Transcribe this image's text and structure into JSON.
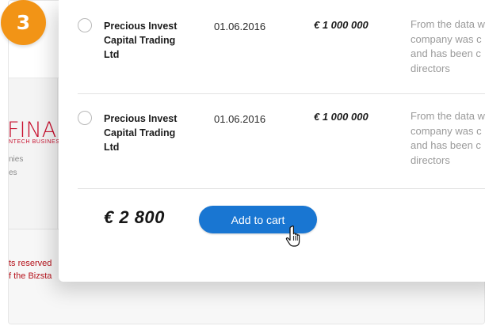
{
  "step_badge": "3",
  "background": {
    "logo_text": "FINAI",
    "logo_subtext": "NTECH BUSINES",
    "side_links": [
      "nies",
      "es"
    ],
    "footer_lines": [
      "ts reserved",
      "f the Bizsta"
    ]
  },
  "listings": [
    {
      "company_lines": [
        "Precious Invest",
        "Capital Trading",
        "Ltd"
      ],
      "date": "01.06.2016",
      "price": "€ 1 000 000",
      "description_lines": [
        "From the data w",
        "company was c",
        "and has been c",
        "directors"
      ]
    },
    {
      "company_lines": [
        "Precious Invest",
        "Capital Trading",
        "Ltd"
      ],
      "date": "01.06.2016",
      "price": "€ 1 000 000",
      "description_lines": [
        "From the data w",
        "company was c",
        "and has been c",
        "directors"
      ]
    }
  ],
  "cart": {
    "total": "€ 2 800",
    "button_label": "Add to cart"
  },
  "colors": {
    "badge": "#f29416",
    "button": "#1976d2",
    "brand_red": "#c8102e"
  },
  "icons": {
    "cursor": "hand-pointer-icon"
  }
}
